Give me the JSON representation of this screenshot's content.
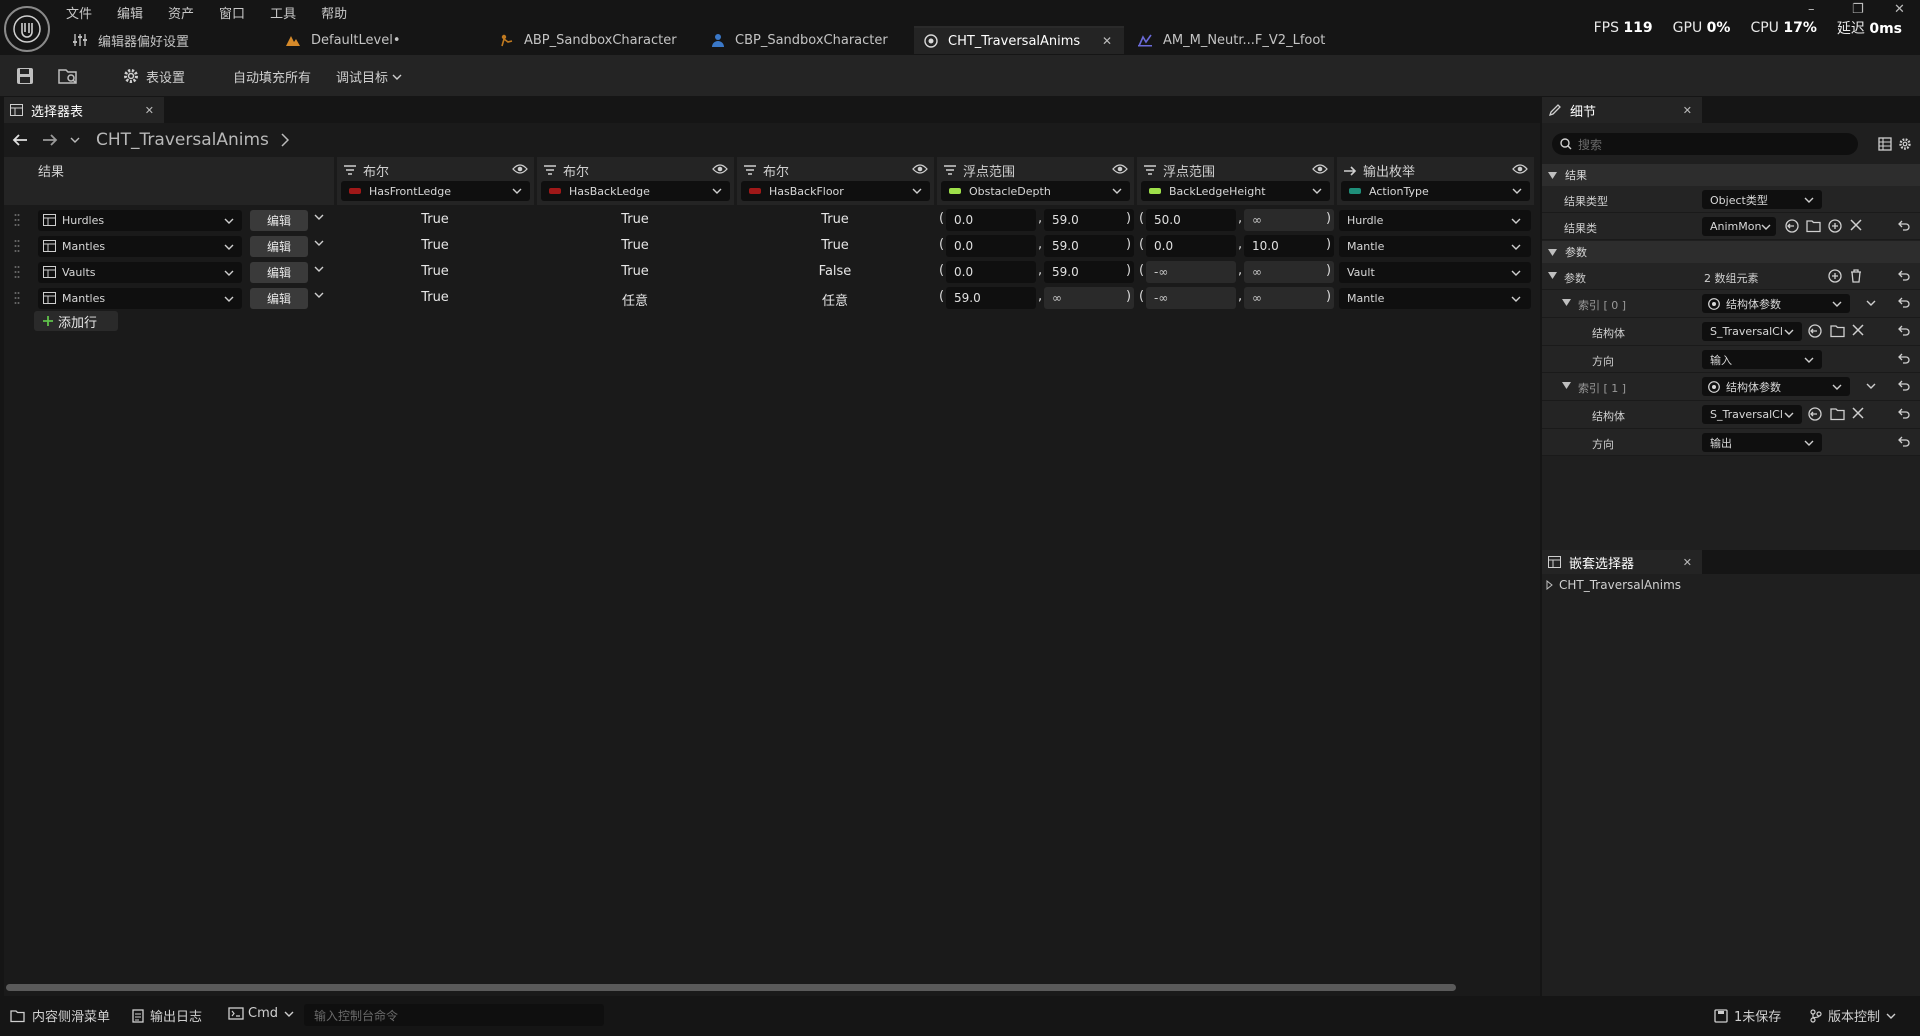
{
  "menu": [
    "文件",
    "编辑",
    "资产",
    "窗口",
    "工具",
    "帮助"
  ],
  "editor_prefs_label": "编辑器偏好设置",
  "tabs": [
    {
      "label": "DefaultLevel•"
    },
    {
      "label": "ABP_SandboxCharacter"
    },
    {
      "label": "CBP_SandboxCharacter"
    },
    {
      "label": "CHT_TraversalAnims",
      "active": true
    },
    {
      "label": "AM_M_Neutr...F_V2_Lfoot"
    }
  ],
  "stats": {
    "fps_label": "FPS",
    "fps_value": "119",
    "gpu_label": "GPU",
    "gpu_value": "0%",
    "cpu_label": "CPU",
    "cpu_value": "17%",
    "latency_label": "延迟",
    "latency_value": "0ms"
  },
  "toolbar": {
    "table_settings": "表设置",
    "autofill_all": "自动填充所有",
    "debug_target": "调试目标"
  },
  "chooser": {
    "panel_title": "选择器表",
    "asset_name": "CHT_TraversalAnims",
    "result_header": "结果",
    "columns": [
      {
        "kind": "布尔",
        "name": "HasFrontLedge",
        "swatch": "#a01818"
      },
      {
        "kind": "布尔",
        "name": "HasBackLedge",
        "swatch": "#a01818"
      },
      {
        "kind": "布尔",
        "name": "HasBackFloor",
        "swatch": "#a01818"
      },
      {
        "kind": "浮点范围",
        "name": "ObstacleDepth",
        "swatch": "#9ee04a"
      },
      {
        "kind": "浮点范围",
        "name": "BackLedgeHeight",
        "swatch": "#9ee04a"
      },
      {
        "kind": "输出枚举",
        "name": "ActionType",
        "swatch": "#1f8f7a"
      }
    ],
    "edit_label": "编辑",
    "add_row_label": "添加行",
    "rows": [
      {
        "result": "Hurdles",
        "front": "True",
        "back": "True",
        "floor": "True",
        "depth_min": "0.0",
        "depth_max": "59.0",
        "height_min": "50.0",
        "height_max": "∞",
        "action": "Hurdle"
      },
      {
        "result": "Mantles",
        "front": "True",
        "back": "True",
        "floor": "True",
        "depth_min": "0.0",
        "depth_max": "59.0",
        "height_min": "0.0",
        "height_max": "10.0",
        "action": "Mantle"
      },
      {
        "result": "Vaults",
        "front": "True",
        "back": "True",
        "floor": "False",
        "depth_min": "0.0",
        "depth_max": "59.0",
        "height_min": "-∞",
        "height_max": "∞",
        "action": "Vault"
      },
      {
        "result": "Mantles",
        "front": "True",
        "back": "任意",
        "floor": "任意",
        "depth_min": "59.0",
        "depth_max": "∞",
        "height_min": "-∞",
        "height_max": "∞",
        "action": "Mantle"
      }
    ]
  },
  "details": {
    "panel_title": "细节",
    "search_placeholder": "搜索",
    "section_result": "结果",
    "result_type_label": "结果类型",
    "result_type_value": "Object类型",
    "result_class_label": "结果类",
    "result_class_value": "AnimMon",
    "section_params": "参数",
    "params_label": "参数",
    "params_count": "2 数组元素",
    "index0_label": "索引 [ 0 ]",
    "index0_value": "结构体参数",
    "struct_label": "结构体",
    "struct0_value": "S_TraversalCl",
    "direction_label": "方向",
    "direction0_value": "输入",
    "index1_label": "索引 [ 1 ]",
    "index1_value": "结构体参数",
    "struct1_value": "S_TraversalCl",
    "direction1_value": "输出"
  },
  "nested": {
    "panel_title": "嵌套选择器",
    "item": "CHT_TraversalAnims"
  },
  "statusbar": {
    "content_drawer": "内容侧滑菜单",
    "output_log": "输出日志",
    "cmd": "Cmd",
    "console_placeholder": "输入控制台命令",
    "unsaved": "1未保存",
    "source_control": "版本控制"
  }
}
